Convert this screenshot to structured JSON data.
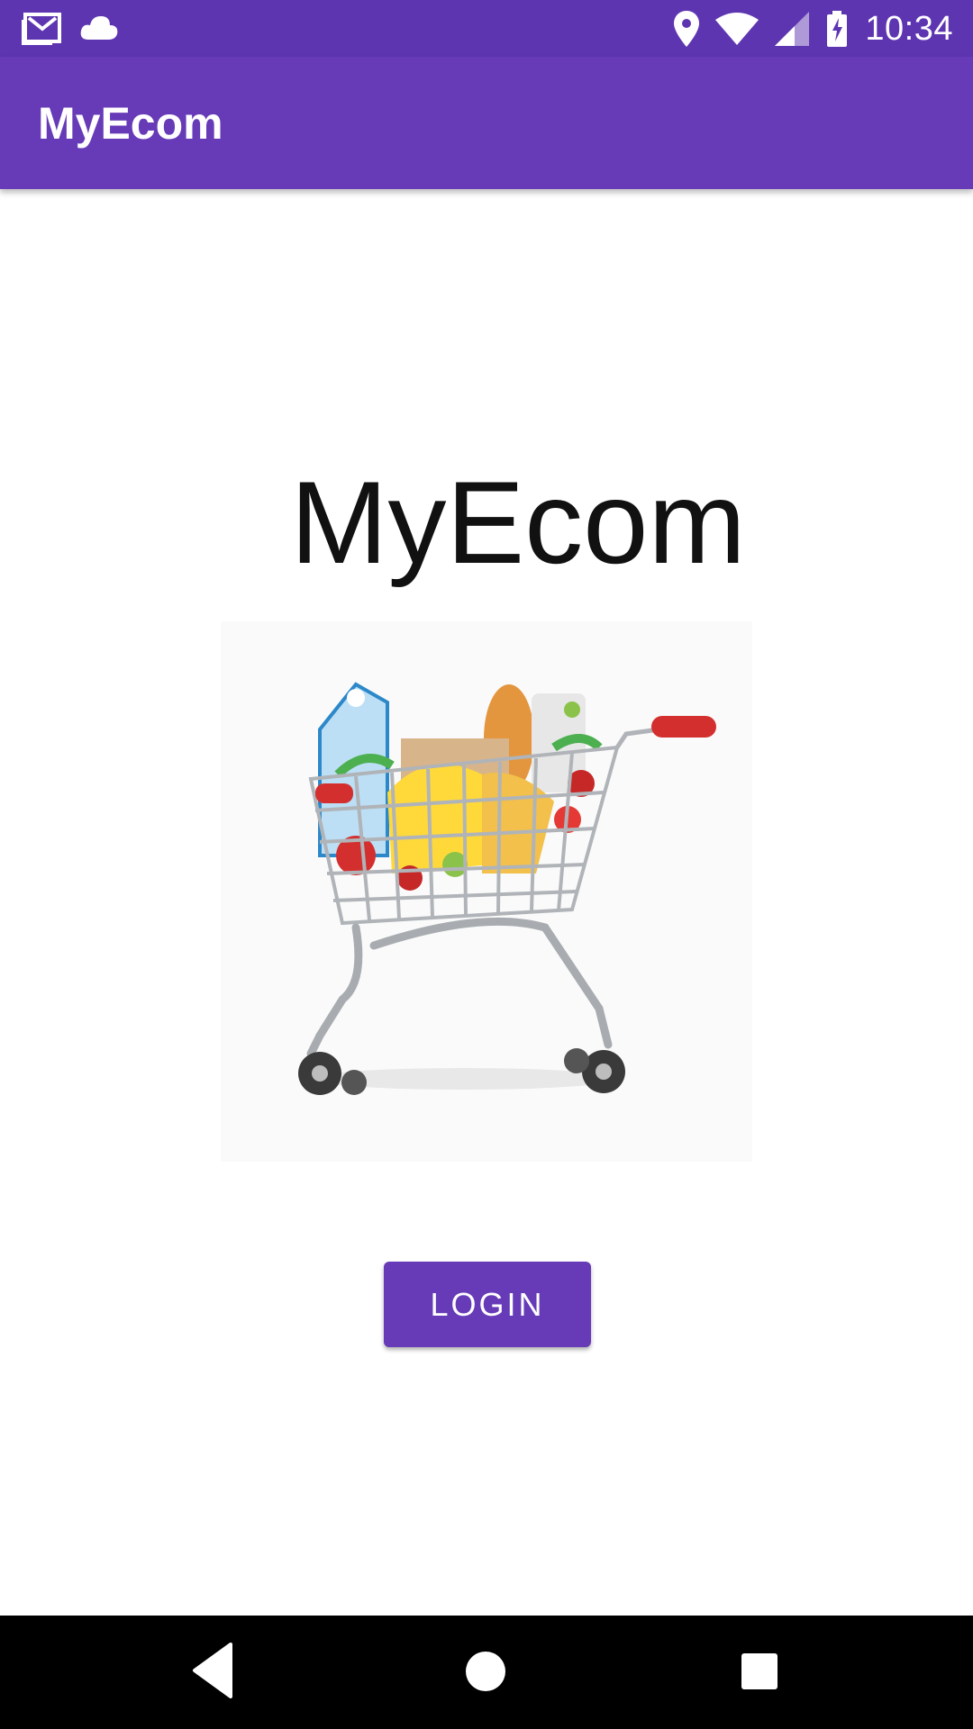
{
  "status_bar": {
    "time": "10:34",
    "icons": [
      "gmail-icon",
      "cloud-icon",
      "location-icon",
      "wifi-icon",
      "signal-icon",
      "battery-icon"
    ]
  },
  "app_bar": {
    "title": "MyEcom"
  },
  "main": {
    "title": "MyEcom",
    "image": "shopping-cart-with-groceries",
    "login_label": "LOGIN"
  },
  "nav_bar": {
    "buttons": [
      "back-icon",
      "home-icon",
      "recents-icon"
    ]
  },
  "colors": {
    "status_bar": "#5e35b1",
    "app_bar": "#673ab7",
    "button": "#673ab7"
  }
}
